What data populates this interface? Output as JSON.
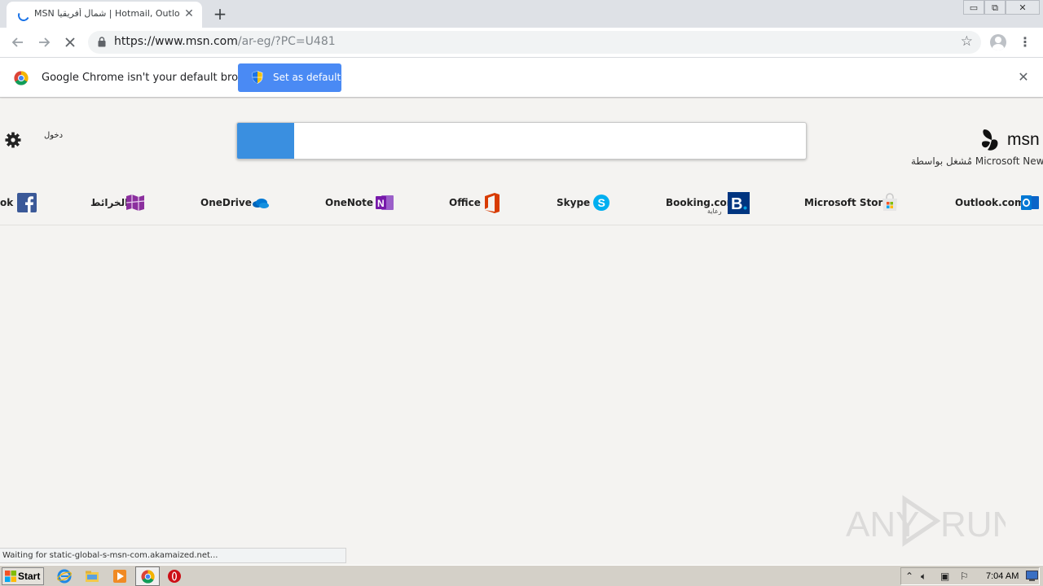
{
  "browser": {
    "tab_title": "MSN شمال أفريقيا | Hotmail, Outlook",
    "tab_close": "✕",
    "new_tab": "+",
    "url_host": "https://www.msn.com",
    "url_path": "/ar-eg/?PC=U481",
    "window_min": "▭",
    "window_max": "⧉",
    "window_close": "✕",
    "menu": "⋮"
  },
  "infobar": {
    "message": "Google Chrome isn't your default browser",
    "button_label": "Set as default",
    "close": "✕"
  },
  "page": {
    "signin_label": "دخول",
    "logo_text": "msn",
    "powered_by": "مُشغل بواسطة Microsoft News",
    "links": [
      {
        "label": "Outlook.com",
        "icon": "outlook-icon"
      },
      {
        "label": "Microsoft Store",
        "icon": "store-icon"
      },
      {
        "label": "Booking.com",
        "sublabel": "رعاية",
        "icon": "booking-icon"
      },
      {
        "label": "Skype",
        "icon": "skype-icon"
      },
      {
        "label": "Office",
        "icon": "office-icon"
      },
      {
        "label": "OneNote",
        "icon": "onenote-icon"
      },
      {
        "label": "OneDrive",
        "icon": "onedrive-icon"
      },
      {
        "label": "الخرائط",
        "icon": "maps-icon"
      },
      {
        "label": "ok",
        "icon": "facebook-icon"
      }
    ]
  },
  "status_text": "Waiting for static-global-s-msn-com.akamaized.net...",
  "watermark": "ANY RUN",
  "taskbar": {
    "start_label": "Start",
    "clock": "7:04 AM"
  },
  "colors": {
    "accent_blue": "#4a8af4",
    "search_loader": "#3a8fe0",
    "page_bg": "#f4f3f1"
  }
}
